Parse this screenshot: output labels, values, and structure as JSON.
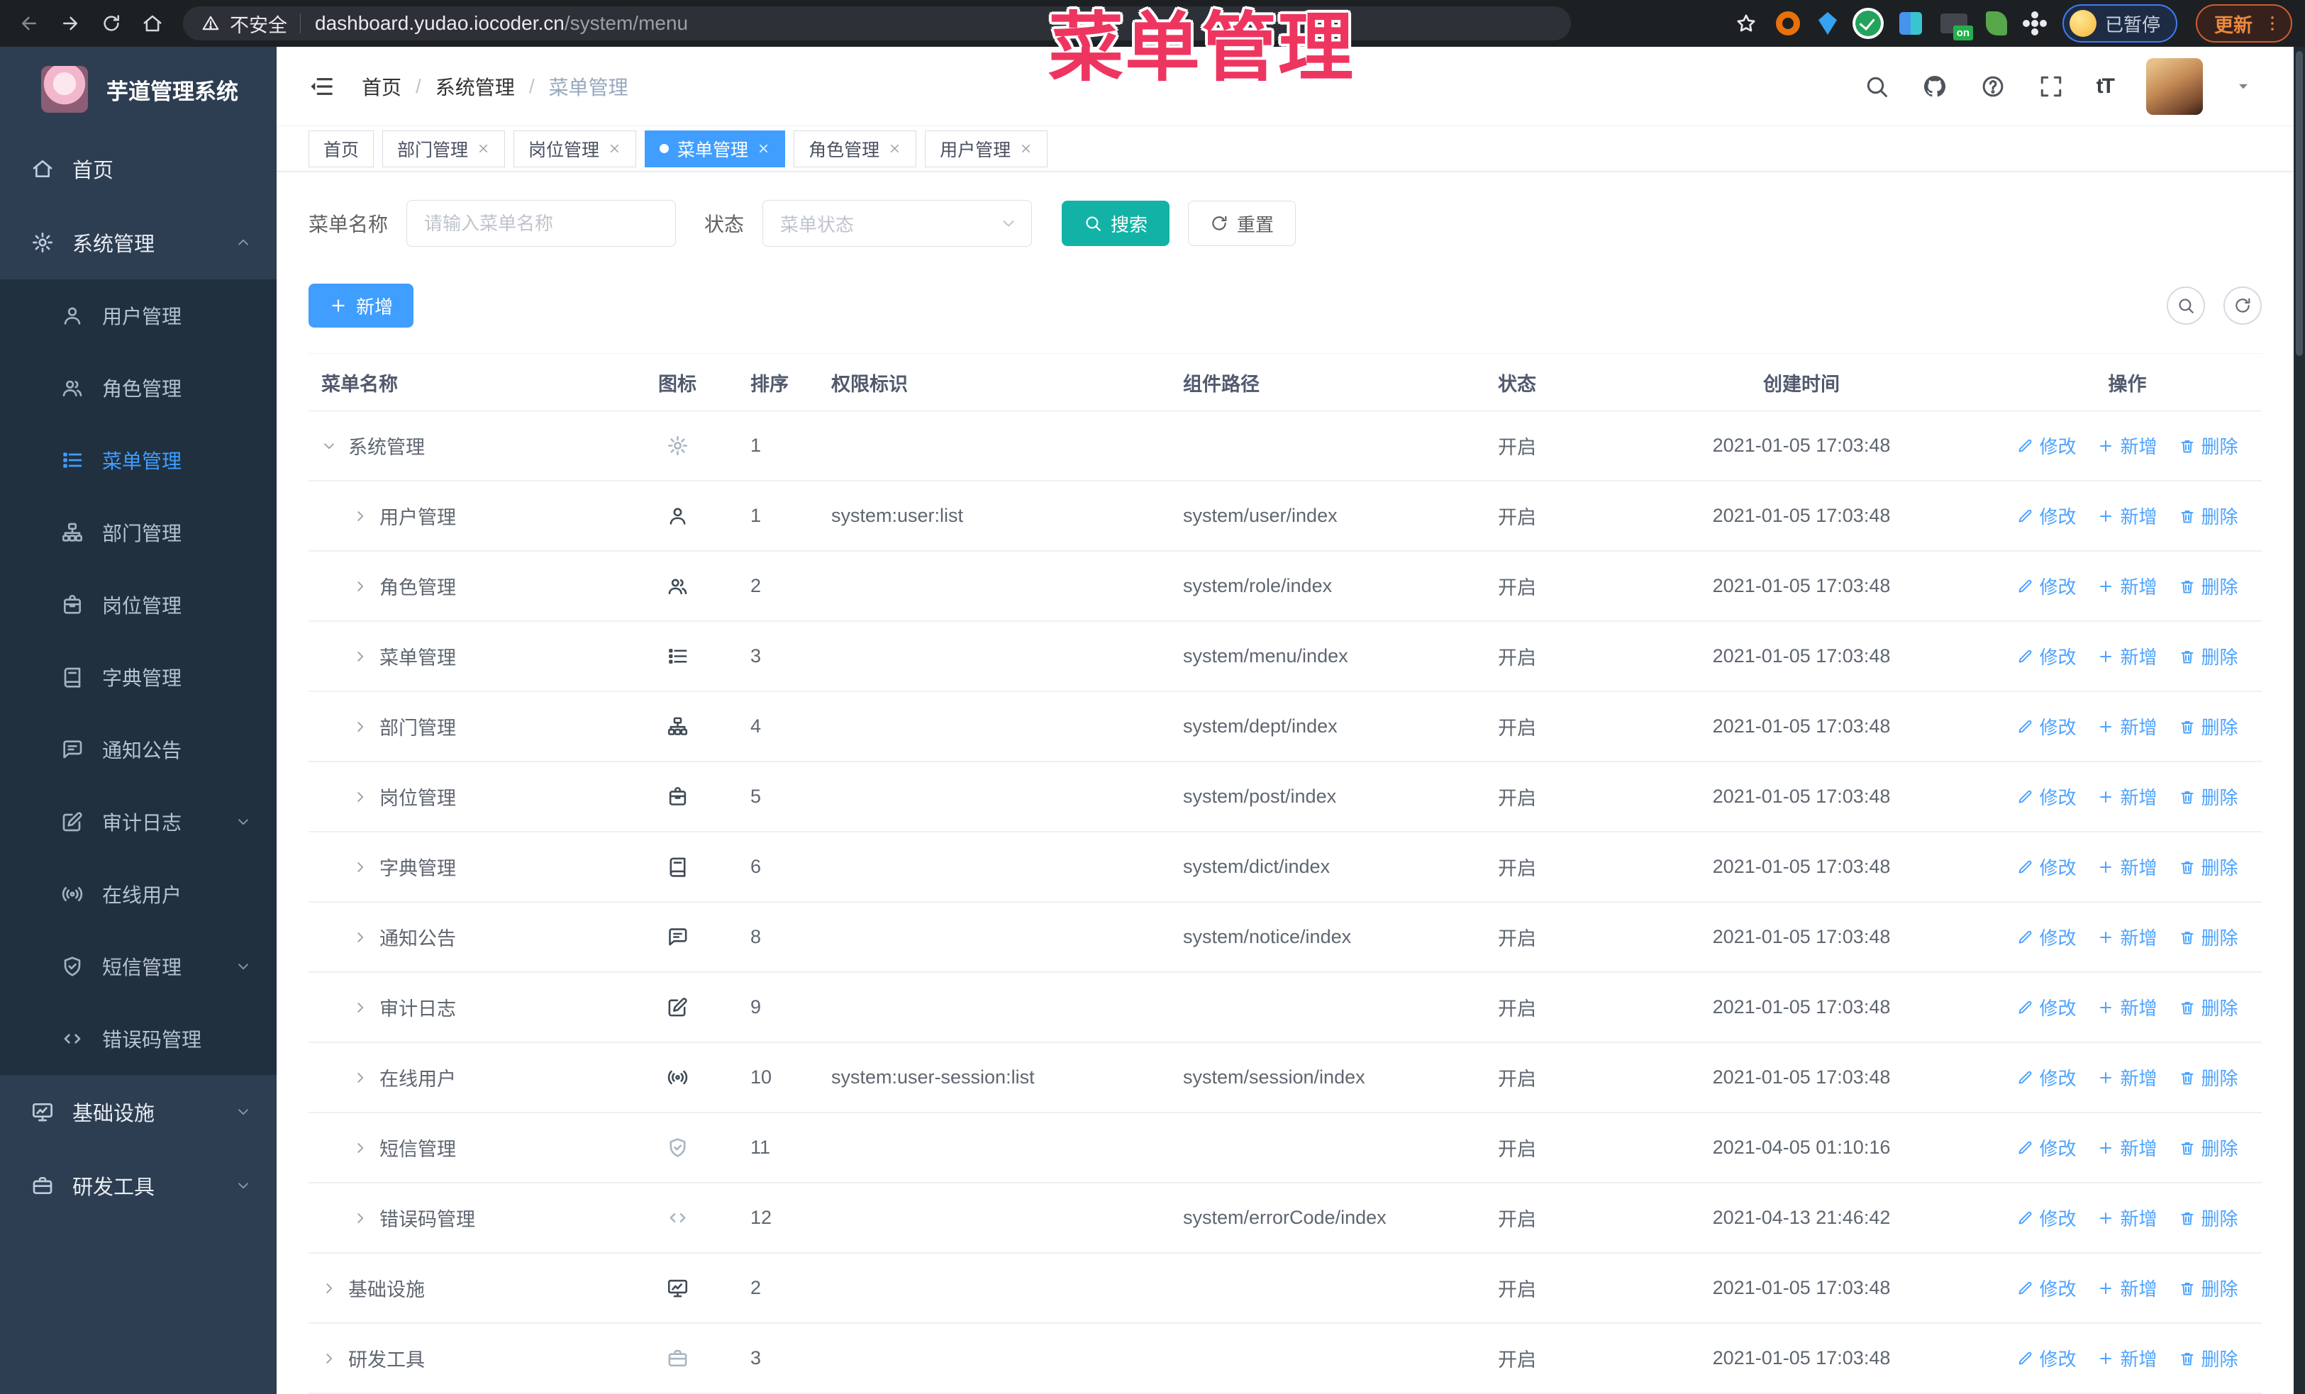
{
  "colors": {
    "accent": "#409eff",
    "teal": "#12b3a6",
    "overlay_red": "#ee3560",
    "sidebar_bg": "#2d3e52",
    "submenu_bg": "#20303f"
  },
  "browser": {
    "security_label": "不安全",
    "url_domain": "dashboard.yudao.iocoder.cn",
    "url_path": "/system/menu",
    "paused_badge": "已暂停",
    "update_label": "更新",
    "extension_icons": [
      "orange-ring-extension-icon",
      "blue-gem-extension-icon",
      "green-check-extension-icon",
      "teal-grid-extension-icon",
      "onoff-extension-icon",
      "green-leaf-extension-icon",
      "white-puzzle-extension-icon"
    ]
  },
  "overlay": {
    "text": "菜单管理"
  },
  "sidebar": {
    "title": "芋道管理系统",
    "items": [
      {
        "key": "home",
        "label": "首页",
        "icon": "home"
      },
      {
        "key": "system",
        "label": "系统管理",
        "icon": "gear",
        "chevron": "up",
        "open": true,
        "children": [
          {
            "key": "user",
            "label": "用户管理",
            "icon": "user"
          },
          {
            "key": "role",
            "label": "角色管理",
            "icon": "users"
          },
          {
            "key": "menu",
            "label": "菜单管理",
            "icon": "menu",
            "active": true
          },
          {
            "key": "dept",
            "label": "部门管理",
            "icon": "tree"
          },
          {
            "key": "post",
            "label": "岗位管理",
            "icon": "badge"
          },
          {
            "key": "dict",
            "label": "字典管理",
            "icon": "book"
          },
          {
            "key": "notice",
            "label": "通知公告",
            "icon": "chat"
          },
          {
            "key": "audit",
            "label": "审计日志",
            "icon": "edit",
            "chevron": "down"
          },
          {
            "key": "online",
            "label": "在线用户",
            "icon": "online"
          },
          {
            "key": "sms",
            "label": "短信管理",
            "icon": "shield",
            "chevron": "down"
          },
          {
            "key": "errcode",
            "label": "错误码管理",
            "icon": "code"
          }
        ]
      },
      {
        "key": "infra",
        "label": "基础设施",
        "icon": "monitor",
        "chevron": "down"
      },
      {
        "key": "devtool",
        "label": "研发工具",
        "icon": "tool",
        "chevron": "down"
      }
    ]
  },
  "header": {
    "breadcrumb": [
      "首页",
      "系统管理",
      "菜单管理"
    ],
    "right_icons": [
      "search-icon",
      "github-icon",
      "help-icon",
      "fullscreen-icon",
      "font-size-icon",
      "user-avatar",
      "caret-down-icon"
    ],
    "font_size_glyph": "tT"
  },
  "tabs": [
    {
      "key": "home",
      "label": "首页",
      "closable": false,
      "active": false
    },
    {
      "key": "dept",
      "label": "部门管理",
      "closable": true,
      "active": false
    },
    {
      "key": "post",
      "label": "岗位管理",
      "closable": true,
      "active": false
    },
    {
      "key": "menu",
      "label": "菜单管理",
      "closable": true,
      "active": true
    },
    {
      "key": "role",
      "label": "角色管理",
      "closable": true,
      "active": false
    },
    {
      "key": "user",
      "label": "用户管理",
      "closable": true,
      "active": false
    }
  ],
  "filter": {
    "name_label": "菜单名称",
    "name_placeholder": "请输入菜单名称",
    "status_label": "状态",
    "status_placeholder": "菜单状态",
    "search_label": "搜索",
    "reset_label": "重置"
  },
  "toolbar": {
    "add_label": "新增"
  },
  "table": {
    "columns": [
      "菜单名称",
      "图标",
      "排序",
      "权限标识",
      "组件路径",
      "状态",
      "创建时间",
      "操作"
    ],
    "row_actions": [
      {
        "key": "edit",
        "icon": "pencil",
        "label": "修改"
      },
      {
        "key": "add",
        "icon": "plus",
        "label": "新增"
      },
      {
        "key": "delete",
        "icon": "trash",
        "label": "删除"
      }
    ],
    "rows": [
      {
        "key": "system",
        "name": "系统管理",
        "icon": "gear",
        "light": true,
        "arrow": "down",
        "child": false,
        "sort": "1",
        "perm": "",
        "path": "",
        "status": "开启",
        "time": "2021-01-05 17:03:48"
      },
      {
        "key": "user",
        "name": "用户管理",
        "icon": "user",
        "arrow": "right",
        "child": true,
        "sort": "1",
        "perm": "system:user:list",
        "path": "system/user/index",
        "status": "开启",
        "time": "2021-01-05 17:03:48"
      },
      {
        "key": "role",
        "name": "角色管理",
        "icon": "users",
        "arrow": "right",
        "child": true,
        "sort": "2",
        "perm": "",
        "path": "system/role/index",
        "status": "开启",
        "time": "2021-01-05 17:03:48"
      },
      {
        "key": "menu",
        "name": "菜单管理",
        "icon": "menu",
        "arrow": "right",
        "child": true,
        "sort": "3",
        "perm": "",
        "path": "system/menu/index",
        "status": "开启",
        "time": "2021-01-05 17:03:48"
      },
      {
        "key": "dept",
        "name": "部门管理",
        "icon": "tree",
        "arrow": "right",
        "child": true,
        "sort": "4",
        "perm": "",
        "path": "system/dept/index",
        "status": "开启",
        "time": "2021-01-05 17:03:48"
      },
      {
        "key": "post",
        "name": "岗位管理",
        "icon": "badge",
        "arrow": "right",
        "child": true,
        "sort": "5",
        "perm": "",
        "path": "system/post/index",
        "status": "开启",
        "time": "2021-01-05 17:03:48"
      },
      {
        "key": "dict",
        "name": "字典管理",
        "icon": "book",
        "arrow": "right",
        "child": true,
        "sort": "6",
        "perm": "",
        "path": "system/dict/index",
        "status": "开启",
        "time": "2021-01-05 17:03:48"
      },
      {
        "key": "notice",
        "name": "通知公告",
        "icon": "chat",
        "arrow": "right",
        "child": true,
        "sort": "8",
        "perm": "",
        "path": "system/notice/index",
        "status": "开启",
        "time": "2021-01-05 17:03:48"
      },
      {
        "key": "audit",
        "name": "审计日志",
        "icon": "edit",
        "arrow": "right",
        "child": true,
        "sort": "9",
        "perm": "",
        "path": "",
        "status": "开启",
        "time": "2021-01-05 17:03:48"
      },
      {
        "key": "online",
        "name": "在线用户",
        "icon": "online",
        "arrow": "right",
        "child": true,
        "sort": "10",
        "perm": "system:user-session:list",
        "path": "system/session/index",
        "status": "开启",
        "time": "2021-01-05 17:03:48"
      },
      {
        "key": "sms",
        "name": "短信管理",
        "icon": "shield",
        "light": true,
        "arrow": "right",
        "child": true,
        "sort": "11",
        "perm": "",
        "path": "",
        "status": "开启",
        "time": "2021-04-05 01:10:16"
      },
      {
        "key": "errcode",
        "name": "错误码管理",
        "icon": "code",
        "light": true,
        "arrow": "right",
        "child": true,
        "sort": "12",
        "perm": "",
        "path": "system/errorCode/index",
        "status": "开启",
        "time": "2021-04-13 21:46:42"
      },
      {
        "key": "infra",
        "name": "基础设施",
        "icon": "monitor",
        "arrow": "right",
        "child": false,
        "sort": "2",
        "perm": "",
        "path": "",
        "status": "开启",
        "time": "2021-01-05 17:03:48"
      },
      {
        "key": "devtool",
        "name": "研发工具",
        "icon": "tool",
        "light": true,
        "arrow": "right",
        "child": false,
        "sort": "3",
        "perm": "",
        "path": "",
        "status": "开启",
        "time": "2021-01-05 17:03:48"
      }
    ]
  }
}
